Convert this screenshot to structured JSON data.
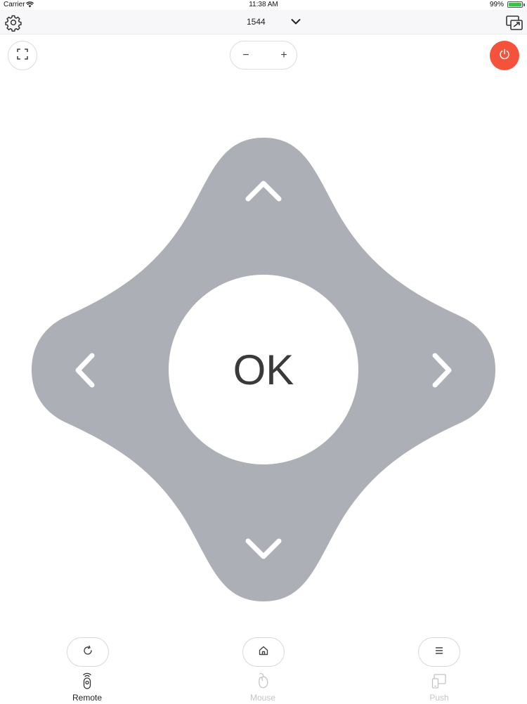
{
  "status_bar": {
    "carrier": "Carrier",
    "time": "11:38 AM",
    "battery_text": "99%",
    "battery_level": 0.99,
    "battery_color": "#3cc24a"
  },
  "nav_bar": {
    "device_name": "1544",
    "icons": {
      "settings": "gear-icon",
      "device_dropdown": "chevron-down-icon",
      "cast": "screen-mirror-icon"
    }
  },
  "controls": {
    "volume_minus": "−",
    "volume_plus": "+",
    "power_color": "#f4523a",
    "icons": {
      "fullscreen": "fullscreen-icon",
      "power": "power-icon"
    }
  },
  "dpad": {
    "ok_label": "OK",
    "pad_color": "#acb0b6",
    "icons": {
      "up": "chevron-up-icon",
      "down": "chevron-down-icon",
      "left": "chevron-left-icon",
      "right": "chevron-right-icon"
    }
  },
  "bottom_buttons": {
    "icons": {
      "back": "refresh-icon",
      "home": "home-icon",
      "menu": "menu-icon"
    }
  },
  "tabs": [
    {
      "label": "Remote",
      "icon": "remote-icon",
      "active": true
    },
    {
      "label": "Mouse",
      "icon": "mouse-icon",
      "active": false
    },
    {
      "label": "Push",
      "icon": "devices-icon",
      "active": false
    }
  ]
}
